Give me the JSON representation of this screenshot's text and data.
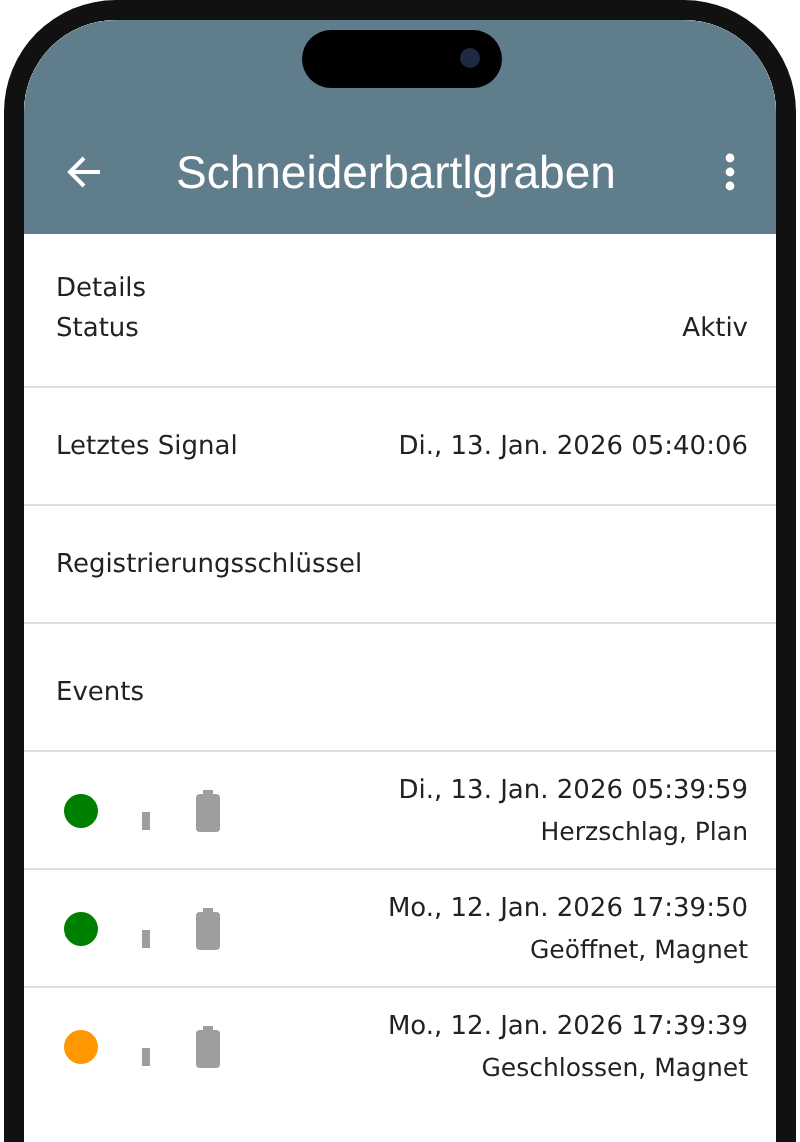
{
  "app_bar": {
    "title": "Schneiderbartlgraben"
  },
  "details": {
    "heading": "Details",
    "rows": [
      {
        "label": "Status",
        "value": "Aktiv"
      },
      {
        "label": "Letztes Signal",
        "value": "Di., 13. Jan. 2026 05:40:06"
      },
      {
        "label": "Registrierungsschlüssel"
      }
    ]
  },
  "events": {
    "heading": "Events",
    "items": [
      {
        "color": "#008000",
        "time": "Di., 13. Jan. 2026 05:39:59",
        "description": "Herzschlag, Plan"
      },
      {
        "color": "#008000",
        "time": "Mo., 12. Jan. 2026 17:39:50",
        "description": "Geöffnet, Magnet"
      },
      {
        "color": "#ff9800",
        "time": "Mo., 12. Jan. 2026 17:39:39",
        "description": "Geschlossen, Magnet"
      }
    ]
  }
}
